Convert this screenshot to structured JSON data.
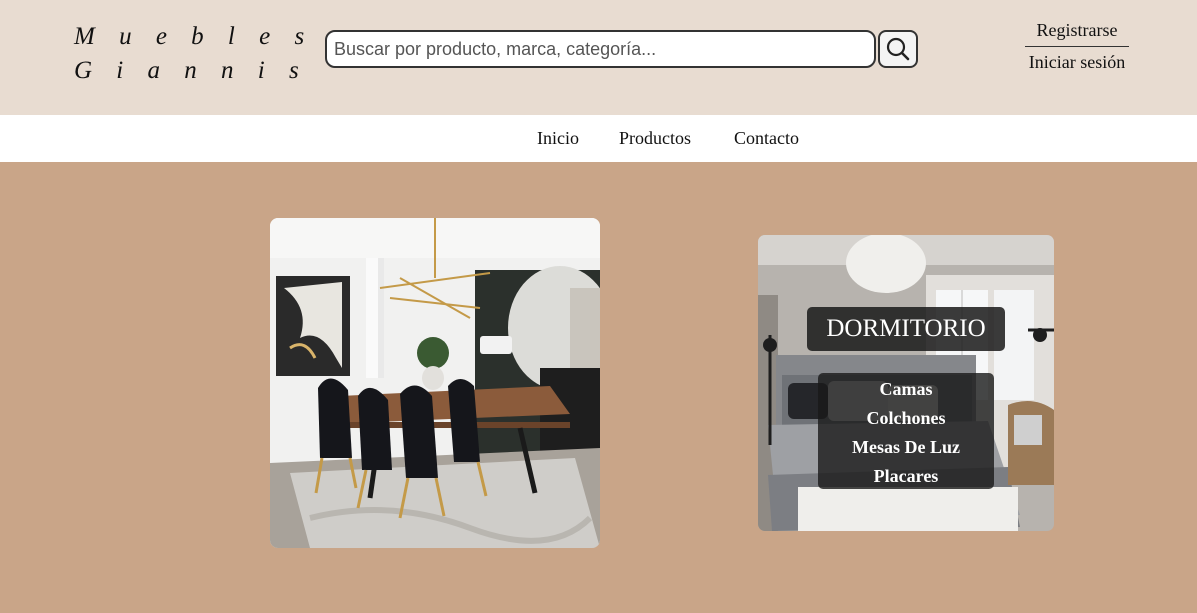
{
  "brand": {
    "line1": "M u e b l e s",
    "line2": "G i a n n i s"
  },
  "search": {
    "placeholder": "Buscar por producto, marca, categoría..."
  },
  "auth": {
    "register_label": "Registrarse",
    "login_label": "Iniciar sesión"
  },
  "nav": {
    "items": [
      {
        "label": "Inicio"
      },
      {
        "label": "Productos"
      },
      {
        "label": "Contacto"
      }
    ]
  },
  "bedroom_card": {
    "title": "DORMITORIO",
    "links": [
      {
        "label": "Camas"
      },
      {
        "label": "Colchones"
      },
      {
        "label": "Mesas De Luz"
      },
      {
        "label": "Placares"
      }
    ]
  },
  "colors": {
    "header_bg": "#e8dcd1",
    "nav_bg": "#ffffff",
    "page_bg": "#c9a588",
    "overlay": "#191919"
  },
  "icons": {
    "search": "magnifier-icon"
  }
}
